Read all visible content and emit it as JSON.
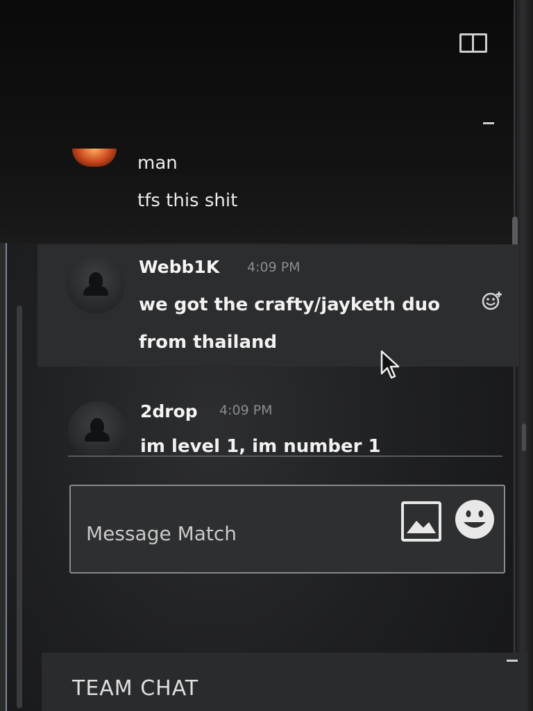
{
  "chat": {
    "prev_lines": [
      "man",
      "tfs this shit"
    ],
    "messages": [
      {
        "username": "Webb1K",
        "time": "4:09 PM",
        "lines": [
          "we got the crafty/jayketh duo",
          "from thailand"
        ]
      },
      {
        "username": "2drop",
        "time": "4:09 PM",
        "lines": [
          "im level 1, im number 1"
        ]
      }
    ]
  },
  "input": {
    "placeholder": "Message Match"
  },
  "team_chat": {
    "title": "TEAM CHAT"
  },
  "icons": {
    "split_view": "split-view-icon",
    "minimize": "minimize-icon",
    "add_reaction": "add-reaction-icon",
    "upload_image": "image-icon",
    "emoji": "emoji-icon",
    "cursor": "mouse-cursor-icon"
  }
}
